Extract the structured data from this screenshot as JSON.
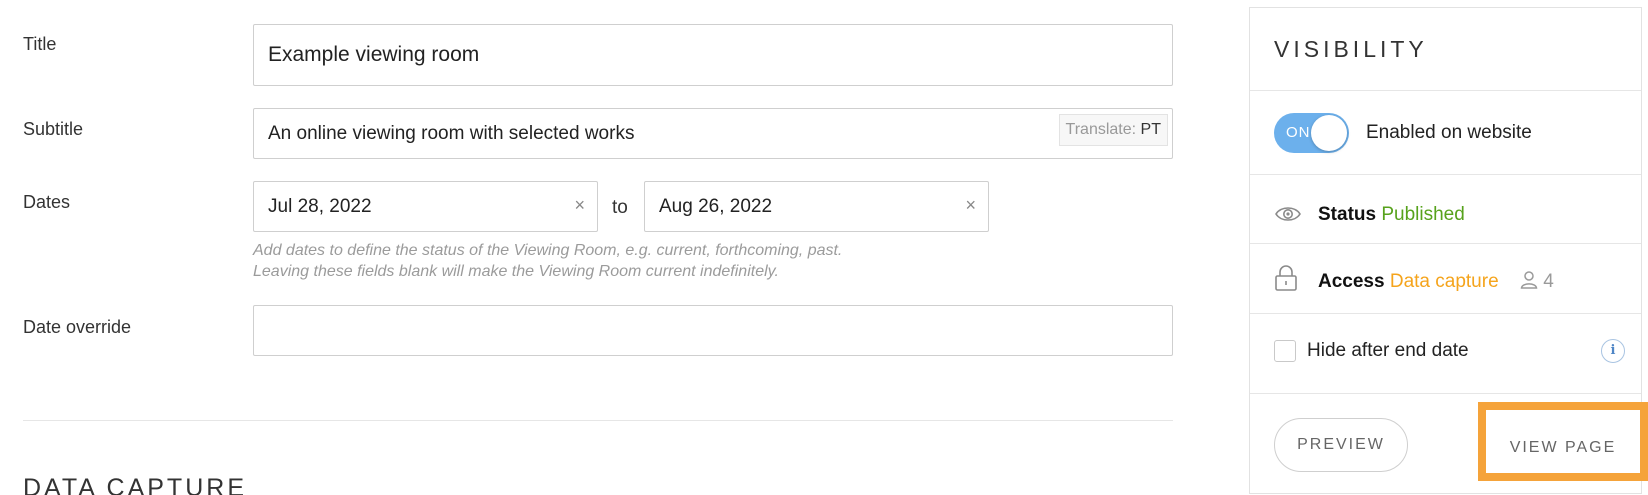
{
  "form": {
    "title_label": "Title",
    "title_value": "Example viewing room",
    "subtitle_label": "Subtitle",
    "subtitle_value": "An online viewing room with selected works",
    "translate_label": "Translate:",
    "translate_lang": "PT",
    "dates_label": "Dates",
    "start_date": "Jul 28, 2022",
    "end_date": "Aug 26, 2022",
    "to_text": "to",
    "clear_symbol": "×",
    "hint_line1": "Add dates to define the status of the Viewing Room, e.g. current, forthcoming, past.",
    "hint_line2": "Leaving these fields blank will make the Viewing Room current indefinitely.",
    "date_override_label": "Date override",
    "date_override_value": ""
  },
  "section": {
    "heading": "DATA CAPTURE"
  },
  "visibility": {
    "title": "VISIBILITY",
    "toggle_state": "ON",
    "toggle_text": "Enabled on website",
    "status_key": "Status",
    "status_value": "Published",
    "status_color": "#57a21c",
    "access_key": "Access",
    "access_value": "Data capture",
    "access_color": "#f5a41c",
    "access_count": "4",
    "hide_label": "Hide after end date",
    "info_symbol": "i",
    "preview_label": "PREVIEW",
    "view_page_label": "VIEW PAGE",
    "highlight_color": "#f5a33a",
    "toggle_color": "#6cb0ec"
  },
  "icons": {
    "status": "eye-icon",
    "access": "lock-icon",
    "users": "user-icon",
    "info": "info-icon",
    "clear": "close-icon"
  }
}
